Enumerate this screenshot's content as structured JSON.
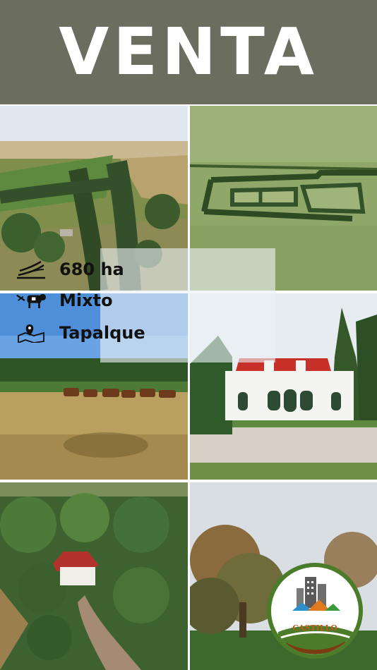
{
  "header": {
    "title": "VENTA"
  },
  "details": [
    {
      "icon": "field-icon",
      "text": "680 ha"
    },
    {
      "icon": "cow-icon",
      "text": "Mixto"
    },
    {
      "icon": "map-pin-icon",
      "text": "Tapalque"
    }
  ],
  "logo": {
    "text": "CASTILLO"
  }
}
